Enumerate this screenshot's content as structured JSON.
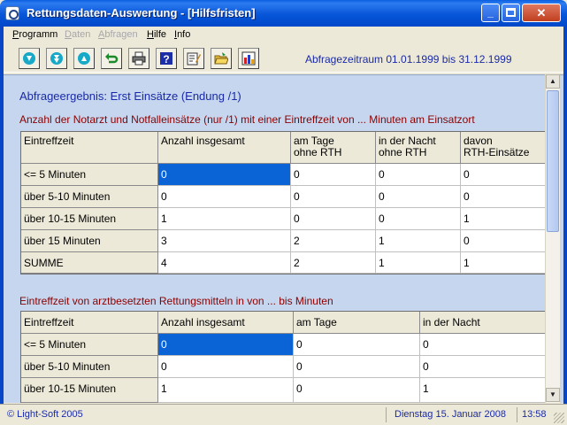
{
  "window": {
    "title": "Rettungsdaten-Auswertung - [Hilfsfristen]"
  },
  "menu": [
    {
      "label": "Programm",
      "underline": "P",
      "rest": "rogramm",
      "enabled": true
    },
    {
      "label": "Daten",
      "underline": "D",
      "rest": "aten",
      "enabled": false
    },
    {
      "label": "Abfragen",
      "underline": "A",
      "rest": "bfragen",
      "enabled": false
    },
    {
      "label": "Hilfe",
      "underline": "H",
      "rest": "ilfe",
      "enabled": true
    },
    {
      "label": "Info",
      "underline": "I",
      "rest": "nfo",
      "enabled": true
    }
  ],
  "toolbar": {
    "buttons": [
      "arrow-down-icon",
      "arrow-down-icon",
      "arrow-up-icon",
      "undo-icon",
      "printer-icon",
      "help-icon",
      "edit-icon",
      "open-folder-icon",
      "chart-icon"
    ],
    "period": "Abfragezeitraum 01.01.1999 bis 31.12.1999"
  },
  "heading": "Abfrageergebnis: Erst Einsätze (Endung /1)",
  "table1": {
    "caption": "Anzahl der Notarzt und Notfalleinsätze (nur /1) mit einer Eintreffzeit von ... Minuten am Einsatzort",
    "headers": [
      {
        "l1": "Eintreffzeit",
        "l2": ""
      },
      {
        "l1": "Anzahl insgesamt",
        "l2": ""
      },
      {
        "l1": "am Tage",
        "l2": "ohne RTH"
      },
      {
        "l1": "in der Nacht",
        "l2": "ohne RTH"
      },
      {
        "l1": "davon",
        "l2": "RTH-Einsätze"
      }
    ],
    "rows": [
      {
        "label": "<= 5 Minuten",
        "values": [
          "0",
          "0",
          "0",
          "0"
        ]
      },
      {
        "label": "über 5-10 Minuten",
        "values": [
          "0",
          "0",
          "0",
          "0"
        ]
      },
      {
        "label": "über 10-15 Minuten",
        "values": [
          "1",
          "0",
          "0",
          "1"
        ]
      },
      {
        "label": "über 15 Minuten",
        "values": [
          "3",
          "2",
          "1",
          "0"
        ]
      },
      {
        "label": "SUMME",
        "values": [
          "4",
          "2",
          "1",
          "1"
        ]
      }
    ]
  },
  "table2": {
    "caption": "Eintreffzeit von arztbesetzten Rettungsmitteln in von ... bis Minuten",
    "headers": [
      "Eintreffzeit",
      "Anzahl insgesamt",
      "am Tage",
      "in der Nacht"
    ],
    "rows": [
      {
        "label": "<= 5 Minuten",
        "values": [
          "0",
          "0",
          "0"
        ]
      },
      {
        "label": "über 5-10 Minuten",
        "values": [
          "0",
          "0",
          "0"
        ]
      },
      {
        "label": "über 10-15 Minuten",
        "values": [
          "1",
          "0",
          "1"
        ]
      }
    ]
  },
  "status": {
    "copyright": "© Light-Soft 2005",
    "date": "Dienstag  15. Januar  2008",
    "time": "13:58"
  },
  "colors": {
    "selection": "#0A64D6",
    "heading": "#1A2AA8",
    "caption": "#8B0000",
    "client": "#C5D6EE"
  }
}
